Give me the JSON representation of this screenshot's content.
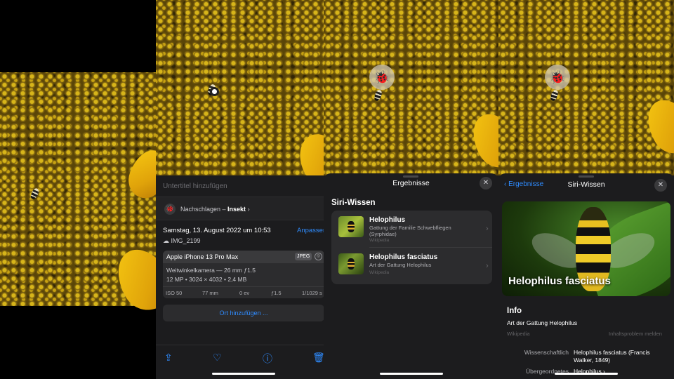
{
  "panel2": {
    "caption_placeholder": "Untertitel hinzufügen",
    "lookup_prefix": "Nachschlagen – ",
    "lookup_subject": "Insekt",
    "date": "Samstag, 13. August 2022 um 10:53",
    "adjust": "Anpassen",
    "filename": "IMG_2199",
    "camera": "Apple iPhone 13 Pro Max",
    "format_badge": "JPEG",
    "lens": "Weitwinkelkamera — 26 mm ƒ1.5",
    "specs": "12 MP  •  3024 × 4032  •  2,4 MB",
    "exif": [
      "ISO 50",
      "77 mm",
      "0 ev",
      "ƒ1.5",
      "1/1029 s"
    ],
    "add_location": "Ort hinzufügen ..."
  },
  "panel3": {
    "title": "Ergebnisse",
    "section": "Siri-Wissen",
    "results": [
      {
        "name": "Helophilus",
        "desc": "Gattung der Familie Schwebfliegen (Syrphidae)",
        "source": "Wikipedia"
      },
      {
        "name": "Helophilus fasciatus",
        "desc": "Art der Gattung Helophilus",
        "source": "Wikipedia"
      }
    ]
  },
  "panel4": {
    "back": "Ergebnisse",
    "title": "Siri-Wissen",
    "hero_title": "Helophilus fasciatus",
    "info_heading": "Info",
    "info_desc": "Art der Gattung Helophilus",
    "source": "Wikipedia",
    "report": "Inhaltsproblem melden",
    "rows": [
      {
        "key": "Wissenschaftlich",
        "value": "Helophilus fasciatus (Francis Walker, 1849)"
      },
      {
        "key": "Übergeordnetes",
        "value": "Helophilus ›"
      }
    ]
  },
  "icons": {
    "close": "✕",
    "chevron": "›",
    "back": "‹",
    "bug": "🐞"
  },
  "colors": {
    "accent": "#2f8cff",
    "background": "#1c1c1e"
  }
}
